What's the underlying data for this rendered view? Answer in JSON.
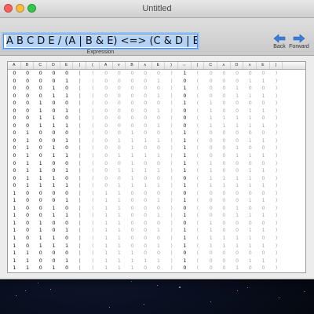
{
  "window": {
    "title": "Untitled"
  },
  "expression": {
    "value": "A B C D E / (A | B & E) <=> (C & D | E)",
    "caption": "Expression"
  },
  "nav": {
    "back_label": "Back",
    "forward_label": "Forward"
  },
  "colors": {
    "accent": "#4a8ae0",
    "selection": "#b5d2f7",
    "dim_text": "#a6a6a6"
  },
  "table": {
    "headers": [
      "A",
      "B",
      "C",
      "D",
      "E",
      "|",
      "(",
      "A",
      "v",
      "B",
      "∧",
      "E",
      ")",
      "⇔",
      "(",
      "C",
      "∧",
      "D",
      "v",
      "E",
      ")"
    ],
    "rows": [
      [
        "0",
        "0",
        "0",
        "0",
        "0",
        "|",
        "(",
        "0",
        "0",
        "0",
        "0",
        "0",
        ")",
        "1",
        "(",
        "0",
        "0",
        "0",
        "0",
        "0",
        ")"
      ],
      [
        "0",
        "0",
        "0",
        "0",
        "1",
        "|",
        "(",
        "0",
        "0",
        "0",
        "0",
        "1",
        ")",
        "0",
        "(",
        "0",
        "0",
        "0",
        "1",
        "1",
        ")"
      ],
      [
        "0",
        "0",
        "0",
        "1",
        "0",
        "|",
        "(",
        "0",
        "0",
        "0",
        "0",
        "0",
        ")",
        "1",
        "(",
        "0",
        "0",
        "1",
        "0",
        "0",
        ")"
      ],
      [
        "0",
        "0",
        "0",
        "1",
        "1",
        "|",
        "(",
        "0",
        "0",
        "0",
        "0",
        "1",
        ")",
        "0",
        "(",
        "0",
        "0",
        "1",
        "1",
        "1",
        ")"
      ],
      [
        "0",
        "0",
        "1",
        "0",
        "0",
        "|",
        "(",
        "0",
        "0",
        "0",
        "0",
        "0",
        ")",
        "1",
        "(",
        "1",
        "0",
        "0",
        "0",
        "0",
        ")"
      ],
      [
        "0",
        "0",
        "1",
        "0",
        "1",
        "|",
        "(",
        "0",
        "0",
        "0",
        "0",
        "1",
        ")",
        "0",
        "(",
        "1",
        "0",
        "0",
        "1",
        "1",
        ")"
      ],
      [
        "0",
        "0",
        "1",
        "1",
        "0",
        "|",
        "(",
        "0",
        "0",
        "0",
        "0",
        "0",
        ")",
        "0",
        "(",
        "1",
        "1",
        "1",
        "1",
        "0",
        ")"
      ],
      [
        "0",
        "0",
        "1",
        "1",
        "1",
        "|",
        "(",
        "0",
        "0",
        "0",
        "0",
        "1",
        ")",
        "0",
        "(",
        "1",
        "1",
        "1",
        "1",
        "1",
        ")"
      ],
      [
        "0",
        "1",
        "0",
        "0",
        "0",
        "|",
        "(",
        "0",
        "0",
        "1",
        "0",
        "0",
        ")",
        "1",
        "(",
        "0",
        "0",
        "0",
        "0",
        "0",
        ")"
      ],
      [
        "0",
        "1",
        "0",
        "0",
        "1",
        "|",
        "(",
        "0",
        "1",
        "1",
        "1",
        "1",
        ")",
        "1",
        "(",
        "0",
        "0",
        "0",
        "1",
        "1",
        ")"
      ],
      [
        "0",
        "1",
        "0",
        "1",
        "0",
        "|",
        "(",
        "0",
        "0",
        "1",
        "0",
        "0",
        ")",
        "1",
        "(",
        "0",
        "0",
        "1",
        "0",
        "0",
        ")"
      ],
      [
        "0",
        "1",
        "0",
        "1",
        "1",
        "|",
        "(",
        "0",
        "1",
        "1",
        "1",
        "1",
        ")",
        "1",
        "(",
        "0",
        "0",
        "1",
        "1",
        "1",
        ")"
      ],
      [
        "0",
        "1",
        "1",
        "0",
        "0",
        "|",
        "(",
        "0",
        "0",
        "1",
        "0",
        "0",
        ")",
        "1",
        "(",
        "1",
        "0",
        "0",
        "0",
        "0",
        ")"
      ],
      [
        "0",
        "1",
        "1",
        "0",
        "1",
        "|",
        "(",
        "0",
        "1",
        "1",
        "1",
        "1",
        ")",
        "1",
        "(",
        "1",
        "0",
        "0",
        "1",
        "1",
        ")"
      ],
      [
        "0",
        "1",
        "1",
        "1",
        "0",
        "|",
        "(",
        "0",
        "0",
        "1",
        "0",
        "0",
        ")",
        "0",
        "(",
        "1",
        "1",
        "1",
        "1",
        "0",
        ")"
      ],
      [
        "0",
        "1",
        "1",
        "1",
        "1",
        "|",
        "(",
        "0",
        "1",
        "1",
        "1",
        "1",
        ")",
        "1",
        "(",
        "1",
        "1",
        "1",
        "1",
        "1",
        ")"
      ],
      [
        "1",
        "0",
        "0",
        "0",
        "0",
        "|",
        "(",
        "1",
        "1",
        "0",
        "0",
        "0",
        ")",
        "0",
        "(",
        "0",
        "0",
        "0",
        "0",
        "0",
        ")"
      ],
      [
        "1",
        "0",
        "0",
        "0",
        "1",
        "|",
        "(",
        "1",
        "1",
        "0",
        "0",
        "1",
        ")",
        "1",
        "(",
        "0",
        "0",
        "0",
        "1",
        "1",
        ")"
      ],
      [
        "1",
        "0",
        "0",
        "1",
        "0",
        "|",
        "(",
        "1",
        "1",
        "0",
        "0",
        "0",
        ")",
        "0",
        "(",
        "0",
        "0",
        "1",
        "0",
        "0",
        ")"
      ],
      [
        "1",
        "0",
        "0",
        "1",
        "1",
        "|",
        "(",
        "1",
        "1",
        "0",
        "0",
        "1",
        ")",
        "1",
        "(",
        "0",
        "0",
        "1",
        "1",
        "1",
        ")"
      ],
      [
        "1",
        "0",
        "1",
        "0",
        "0",
        "|",
        "(",
        "1",
        "1",
        "0",
        "0",
        "0",
        ")",
        "0",
        "(",
        "1",
        "0",
        "0",
        "0",
        "0",
        ")"
      ],
      [
        "1",
        "0",
        "1",
        "0",
        "1",
        "|",
        "(",
        "1",
        "1",
        "0",
        "0",
        "1",
        ")",
        "1",
        "(",
        "1",
        "0",
        "0",
        "1",
        "1",
        ")"
      ],
      [
        "1",
        "0",
        "1",
        "1",
        "0",
        "|",
        "(",
        "1",
        "1",
        "0",
        "0",
        "0",
        ")",
        "1",
        "(",
        "1",
        "1",
        "1",
        "1",
        "0",
        ")"
      ],
      [
        "1",
        "0",
        "1",
        "1",
        "1",
        "|",
        "(",
        "1",
        "1",
        "0",
        "0",
        "1",
        ")",
        "1",
        "(",
        "1",
        "1",
        "1",
        "1",
        "1",
        ")"
      ],
      [
        "1",
        "1",
        "0",
        "0",
        "0",
        "|",
        "(",
        "1",
        "1",
        "1",
        "0",
        "0",
        ")",
        "0",
        "(",
        "0",
        "0",
        "0",
        "0",
        "0",
        ")"
      ],
      [
        "1",
        "1",
        "0",
        "0",
        "1",
        "|",
        "(",
        "1",
        "1",
        "1",
        "1",
        "1",
        ")",
        "1",
        "(",
        "0",
        "0",
        "0",
        "1",
        "1",
        ")"
      ],
      [
        "1",
        "1",
        "0",
        "1",
        "0",
        "|",
        "(",
        "1",
        "1",
        "1",
        "0",
        "0",
        ")",
        "0",
        "(",
        "0",
        "0",
        "1",
        "0",
        "0",
        ")"
      ]
    ]
  }
}
